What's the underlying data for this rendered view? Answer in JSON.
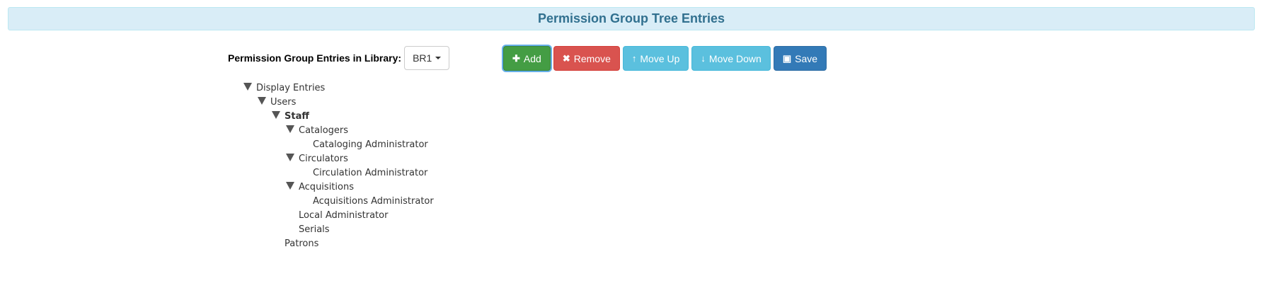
{
  "header": {
    "title": "Permission Group Tree Entries"
  },
  "library": {
    "label": "Permission Group Entries in Library:",
    "selected": "BR1"
  },
  "buttons": {
    "add": "Add",
    "remove": "Remove",
    "move_up": "Move Up",
    "move_down": "Move Down",
    "save": "Save"
  },
  "tree": [
    {
      "label": "Display Entries",
      "depth": 0,
      "expanded": true
    },
    {
      "label": "Users",
      "depth": 1,
      "expanded": true
    },
    {
      "label": "Staff",
      "depth": 2,
      "expanded": true,
      "selected": true
    },
    {
      "label": "Catalogers",
      "depth": 3,
      "expanded": true
    },
    {
      "label": "Cataloging Administrator",
      "depth": 4
    },
    {
      "label": "Circulators",
      "depth": 3,
      "expanded": true
    },
    {
      "label": "Circulation Administrator",
      "depth": 4
    },
    {
      "label": "Acquisitions",
      "depth": 3,
      "expanded": true
    },
    {
      "label": "Acquisitions Administrator",
      "depth": 4
    },
    {
      "label": "Local Administrator",
      "depth": 3
    },
    {
      "label": "Serials",
      "depth": 3
    },
    {
      "label": "Patrons",
      "depth": 2
    }
  ]
}
